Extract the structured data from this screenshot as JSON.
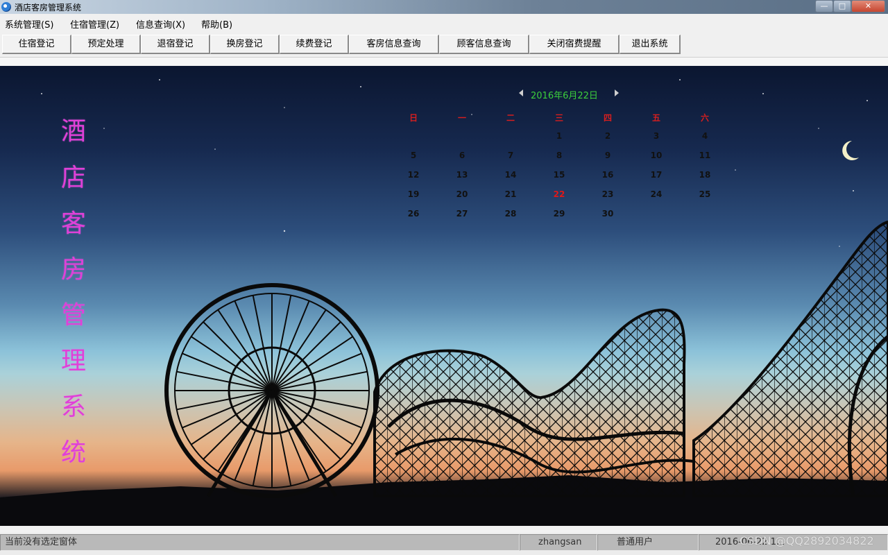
{
  "window": {
    "title": "酒店客房管理系统",
    "controls": {
      "minimize": "—",
      "maximize": "□",
      "close": "✕"
    }
  },
  "menu": [
    "系统管理(S)",
    "住宿管理(Z)",
    "信息查询(X)",
    "帮助(B)"
  ],
  "toolbar": [
    "住宿登记",
    "预定处理",
    "退宿登记",
    "换房登记",
    "续费登记",
    "客房信息查询",
    "顾客信息查询",
    "关闭宿费提醒",
    "退出系统"
  ],
  "vertical_title": [
    "酒",
    "店",
    "客",
    "房",
    "管",
    "理",
    "系",
    "统"
  ],
  "calendar": {
    "title": "2016年6月22日",
    "weekdays": [
      "日",
      "一",
      "二",
      "三",
      "四",
      "五",
      "六"
    ],
    "weeks": [
      [
        "",
        "",
        "",
        "1",
        "2",
        "3",
        "4"
      ],
      [
        "5",
        "6",
        "7",
        "8",
        "9",
        "10",
        "11"
      ],
      [
        "12",
        "13",
        "14",
        "15",
        "16",
        "17",
        "18"
      ],
      [
        "19",
        "20",
        "21",
        "22",
        "23",
        "24",
        "25"
      ],
      [
        "26",
        "27",
        "28",
        "29",
        "30",
        "",
        ""
      ]
    ],
    "selected_day": "22",
    "colors": {
      "title": "#3ccf3c",
      "weekday": "#d81e1e",
      "selected": "#e01818",
      "day": "#111111"
    }
  },
  "status": {
    "message": "当前没有选定窗体",
    "user": "zhangsan",
    "role": "普通用户",
    "datetime": "2016-06-22 1..."
  },
  "watermark": "CSDN @QQ2892034822",
  "colors": {
    "title_gradient_accent": "#e040d8"
  }
}
